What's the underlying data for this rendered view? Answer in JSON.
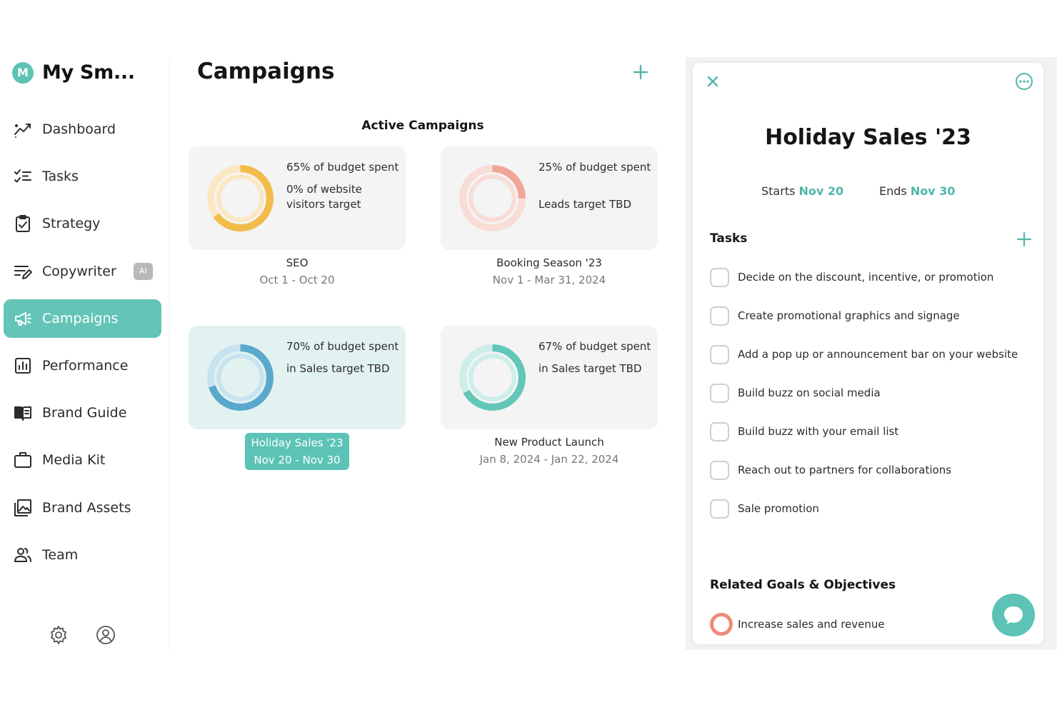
{
  "brand": {
    "avatar_letter": "M",
    "name": "My Sm..."
  },
  "sidebar": {
    "items": [
      {
        "label": "Dashboard",
        "icon": "dashboard-trend-icon"
      },
      {
        "label": "Tasks",
        "icon": "checklist-icon"
      },
      {
        "label": "Strategy",
        "icon": "clipboard-check-icon"
      },
      {
        "label": "Copywriter",
        "icon": "edit-lines-icon",
        "badge": "AI"
      },
      {
        "label": "Campaigns",
        "icon": "megaphone-icon",
        "active": true
      },
      {
        "label": "Performance",
        "icon": "bar-chart-icon"
      },
      {
        "label": "Brand Guide",
        "icon": "book-icon"
      },
      {
        "label": "Media Kit",
        "icon": "briefcase-icon"
      },
      {
        "label": "Brand Assets",
        "icon": "image-gallery-icon"
      },
      {
        "label": "Team",
        "icon": "team-icon"
      }
    ],
    "bottom_icons": [
      "gear-icon",
      "user-circle-icon"
    ]
  },
  "main": {
    "title": "Campaigns",
    "section_title": "Active Campaigns",
    "campaigns": [
      {
        "line1": "65% of budget spent",
        "line2": "0% of website visitors target",
        "name": "SEO",
        "dates": "Oct 1 - Oct 20",
        "budget_pct": 65,
        "target_pct": 0,
        "color": "#f2bc4a",
        "track": "#fbe7c2"
      },
      {
        "line1": "25% of budget spent",
        "line2": "Leads target TBD",
        "name": "Booking Season '23",
        "dates": "Nov 1 - Mar 31, 2024",
        "budget_pct": 25,
        "target_pct": 0,
        "color": "#f1a597",
        "track": "#f8dcd6"
      },
      {
        "line1": "70% of budget spent",
        "line2": "in Sales target TBD",
        "name": "Holiday Sales '23",
        "dates": "Nov 20 - Nov 30",
        "budget_pct": 70,
        "target_pct": 0,
        "color": "#5aa9cc",
        "track": "#c7e3ef",
        "selected": true
      },
      {
        "line1": "67% of budget spent",
        "line2": "in Sales target TBD",
        "name": "New Product Launch",
        "dates": "Jan 8, 2024 - Jan 22, 2024",
        "budget_pct": 67,
        "target_pct": 0,
        "color": "#62c7b8",
        "track": "#cdeee9"
      }
    ]
  },
  "detail": {
    "title": "Holiday Sales '23",
    "starts_label": "Starts",
    "starts_value": "Nov 20",
    "ends_label": "Ends",
    "ends_value": "Nov 30",
    "tasks_heading": "Tasks",
    "tasks": [
      "Decide on the discount, incentive, or promotion",
      "Create promotional graphics and signage",
      "Add a pop up or announcement bar on your website",
      "Build buzz on social media",
      "Build buzz with your email list",
      "Reach out to partners for collaborations",
      "Sale promotion"
    ],
    "goals_heading": "Related Goals & Objectives",
    "goals": [
      "Increase sales and revenue"
    ]
  },
  "colors": {
    "accent": "#5cc3b6",
    "accent_text": "#4fb6a9",
    "goal_ring": "#ef8a7a"
  }
}
